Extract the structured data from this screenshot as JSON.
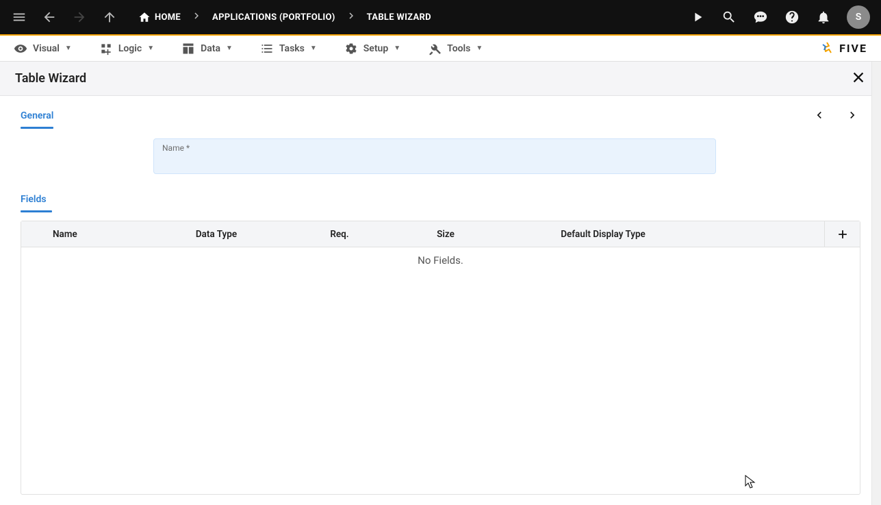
{
  "topbar": {
    "breadcrumbs": {
      "home": "HOME",
      "applications": "APPLICATIONS (PORTFOLIO)",
      "current": "TABLE WIZARD"
    },
    "avatar_initial": "S"
  },
  "menubar": {
    "visual": "Visual",
    "logic": "Logic",
    "data": "Data",
    "tasks": "Tasks",
    "setup": "Setup",
    "tools": "Tools",
    "brand": "FIVE"
  },
  "panel": {
    "title": "Table Wizard"
  },
  "general": {
    "section_label": "General",
    "name_label": "Name *",
    "name_value": ""
  },
  "fields": {
    "section_label": "Fields",
    "columns": {
      "name": "Name",
      "data_type": "Data Type",
      "req": "Req.",
      "size": "Size",
      "default_display_type": "Default Display Type"
    },
    "empty_message": "No Fields."
  }
}
